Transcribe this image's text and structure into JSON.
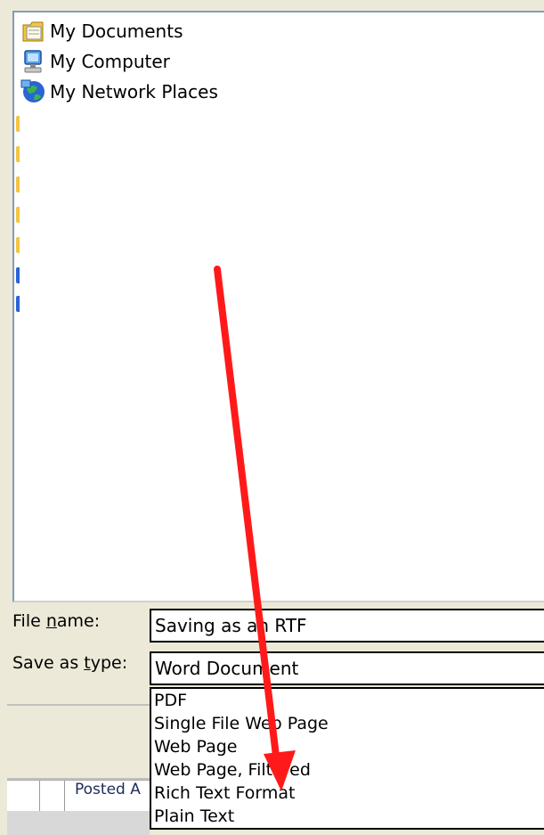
{
  "places": [
    {
      "label": "My Documents",
      "icon": "my-documents-icon"
    },
    {
      "label": "My Computer",
      "icon": "my-computer-icon"
    },
    {
      "label": "My Network Places",
      "icon": "my-network-places-icon"
    }
  ],
  "file_name": {
    "label_pre": "File ",
    "label_accel": "n",
    "label_post": "ame:",
    "value": "Saving as an RTF"
  },
  "save_as_type": {
    "label_pre": "Save as ",
    "label_accel": "t",
    "label_post": "ype:",
    "value": "Word Document",
    "options": [
      "PDF",
      "Single File Web Page",
      "Web Page",
      "Web Page, Filtered",
      "Rich Text Format",
      "Plain Text"
    ]
  },
  "background_window": {
    "text": "Posted A"
  },
  "colors": {
    "dialog_bg": "#ece9d8",
    "annotation_arrow": "#ff1a1a",
    "folder_yellow": "#f5c542",
    "network_blue": "#2a64d6"
  }
}
